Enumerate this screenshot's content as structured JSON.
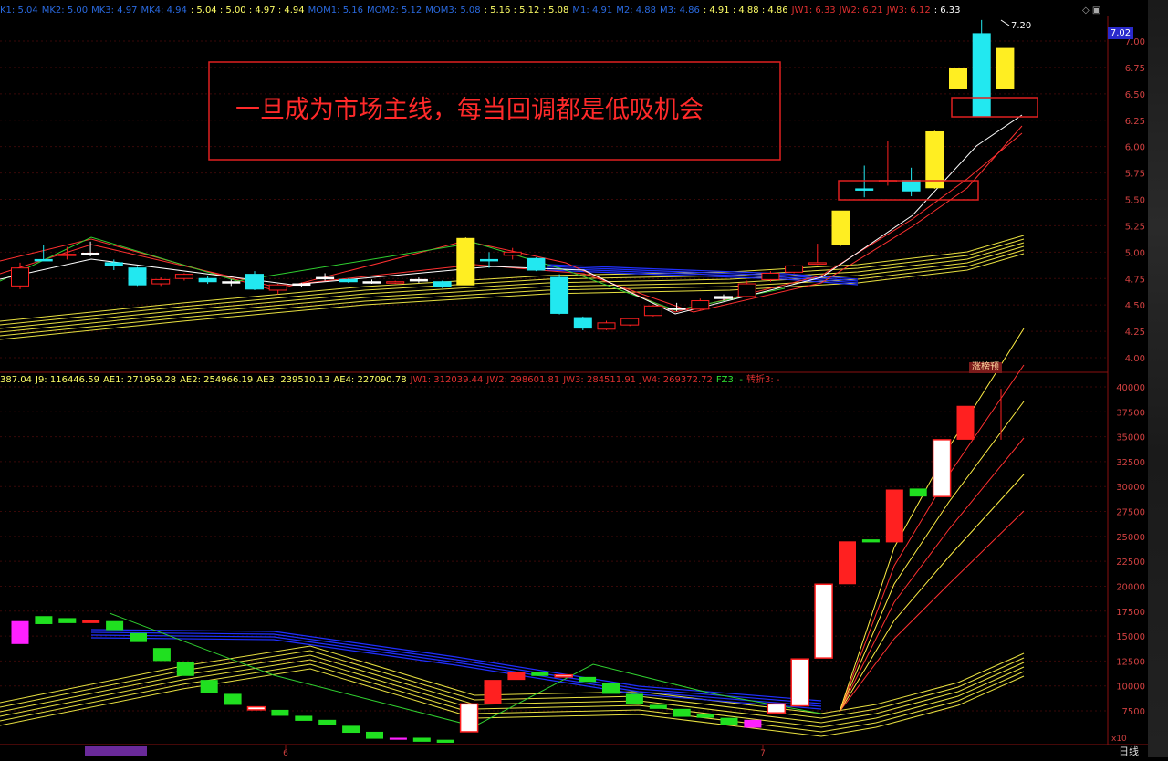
{
  "top_indicators": [
    {
      "text": "K1: 5.04",
      "color": "#2a6ae0"
    },
    {
      "text": "MK2: 5.00",
      "color": "#2a6ae0"
    },
    {
      "text": "MK3: 4.97",
      "color": "#2a6ae0"
    },
    {
      "text": "MK4: 4.94",
      "color": "#2a6ae0"
    },
    {
      "text": ": 5.04 : 5.00 : 4.97 : 4.94",
      "color": "#ffff66"
    },
    {
      "text": "MOM1: 5.16",
      "color": "#2a6ae0"
    },
    {
      "text": "MOM2: 5.12",
      "color": "#2a6ae0"
    },
    {
      "text": "MOM3: 5.08",
      "color": "#2a6ae0"
    },
    {
      "text": ": 5.16 : 5.12 : 5.08",
      "color": "#ffff66"
    },
    {
      "text": "M1: 4.91",
      "color": "#2a6ae0"
    },
    {
      "text": "M2: 4.88",
      "color": "#2a6ae0"
    },
    {
      "text": "M3: 4.86",
      "color": "#2a6ae0"
    },
    {
      "text": ": 4.91 : 4.88 : 4.86",
      "color": "#ffff66"
    },
    {
      "text": "JW1: 6.33",
      "color": "#e03030"
    },
    {
      "text": "JW2: 6.21",
      "color": "#e03030"
    },
    {
      "text": "JW3: 6.12",
      "color": "#e03030"
    },
    {
      "text": ": 6.33",
      "color": "#ffffff"
    }
  ],
  "bottom_indicators": [
    {
      "text": "387.04",
      "color": "#ffff66"
    },
    {
      "text": "J9: 116446.59",
      "color": "#ffff66"
    },
    {
      "text": "AE1: 271959.28",
      "color": "#ffff66"
    },
    {
      "text": "AE2: 254966.19",
      "color": "#ffff66"
    },
    {
      "text": "AE3: 239510.13",
      "color": "#ffff66"
    },
    {
      "text": "AE4: 227090.78",
      "color": "#ffff66"
    },
    {
      "text": "JW1: 312039.44",
      "color": "#e03030"
    },
    {
      "text": "JW2: 298601.81",
      "color": "#e03030"
    },
    {
      "text": "JW3: 284511.91",
      "color": "#e03030"
    },
    {
      "text": "JW4: 269372.72",
      "color": "#e03030"
    },
    {
      "text": "FZ3: -",
      "color": "#30e030"
    },
    {
      "text": "转折3: -",
      "color": "#e03030"
    }
  ],
  "annotation_text": "一旦成为市场主线，每当回调都是低吸机会",
  "price_badge": "7.02",
  "peak_label": "7.20",
  "zhangtingyu_label": "涨榜预",
  "period_label": "日线",
  "x_axis_labels": [
    "6",
    "7"
  ],
  "price_axis": {
    "ticks": [
      "7.00",
      "6.75",
      "6.50",
      "6.25",
      "6.00",
      "5.75",
      "5.50",
      "5.25",
      "5.00",
      "4.75",
      "4.50",
      "4.25",
      "4.00"
    ],
    "range": [
      3.9,
      7.3
    ]
  },
  "volume_axis": {
    "ticks": [
      "40000",
      "37500",
      "35000",
      "32500",
      "30000",
      "27500",
      "25000",
      "22500",
      "20000",
      "17500",
      "15000",
      "12500",
      "10000",
      "7500"
    ],
    "range": [
      5000,
      41000
    ]
  },
  "bottom_right_label": "x10",
  "chart_data": {
    "type": "candlestick",
    "price_candles": [
      [
        4.68,
        4.85,
        4.65,
        4.9,
        "red"
      ],
      [
        4.93,
        4.93,
        4.92,
        5.07,
        "cyan"
      ],
      [
        4.97,
        4.98,
        4.93,
        5.05,
        "red"
      ],
      [
        4.99,
        4.99,
        4.96,
        5.1,
        "white"
      ],
      [
        4.9,
        4.87,
        4.83,
        4.93,
        "cyan"
      ],
      [
        4.85,
        4.69,
        4.68,
        4.86,
        "cyan"
      ],
      [
        4.7,
        4.74,
        4.68,
        4.76,
        "red"
      ],
      [
        4.75,
        4.79,
        4.73,
        4.8,
        "red"
      ],
      [
        4.75,
        4.72,
        4.7,
        4.77,
        "cyan"
      ],
      [
        4.72,
        4.71,
        4.68,
        4.74,
        "white"
      ],
      [
        4.79,
        4.65,
        4.64,
        4.82,
        "cyan"
      ],
      [
        4.64,
        4.69,
        4.6,
        4.7,
        "red"
      ],
      [
        4.69,
        4.7,
        4.67,
        4.71,
        "white"
      ],
      [
        4.76,
        4.76,
        4.73,
        4.8,
        "white"
      ],
      [
        4.74,
        4.72,
        4.71,
        4.75,
        "cyan"
      ],
      [
        4.72,
        4.72,
        4.7,
        4.74,
        "white"
      ],
      [
        4.71,
        4.72,
        4.7,
        4.73,
        "red"
      ],
      [
        4.73,
        4.74,
        4.71,
        4.76,
        "white"
      ],
      [
        4.72,
        4.67,
        4.66,
        4.73,
        "cyan"
      ],
      [
        4.69,
        5.13,
        4.69,
        5.14,
        "yellow"
      ],
      [
        4.93,
        4.93,
        4.85,
        5.0,
        "cyan"
      ],
      [
        4.97,
        5.0,
        4.93,
        5.04,
        "red"
      ],
      [
        4.94,
        4.83,
        4.82,
        4.95,
        "cyan"
      ],
      [
        4.76,
        4.42,
        4.41,
        4.79,
        "cyan"
      ],
      [
        4.38,
        4.28,
        4.26,
        4.39,
        "cyan"
      ],
      [
        4.27,
        4.33,
        4.26,
        4.35,
        "red"
      ],
      [
        4.31,
        4.37,
        4.3,
        4.38,
        "red"
      ],
      [
        4.4,
        4.49,
        4.39,
        4.5,
        "red"
      ],
      [
        4.47,
        4.47,
        4.44,
        4.52,
        "white"
      ],
      [
        4.46,
        4.54,
        4.45,
        4.56,
        "red"
      ],
      [
        4.56,
        4.58,
        4.54,
        4.6,
        "white"
      ],
      [
        4.58,
        4.7,
        4.57,
        4.73,
        "red"
      ],
      [
        4.74,
        4.8,
        4.72,
        4.82,
        "red"
      ],
      [
        4.81,
        4.87,
        4.8,
        4.88,
        "red"
      ],
      [
        4.9,
        4.9,
        4.88,
        5.08,
        "red"
      ],
      [
        5.07,
        5.39,
        5.06,
        5.39,
        "yellow"
      ],
      [
        5.6,
        5.6,
        5.52,
        5.82,
        "cyan"
      ],
      [
        5.67,
        5.68,
        5.63,
        6.05,
        "red"
      ],
      [
        5.68,
        5.58,
        5.53,
        5.8,
        "cyan"
      ],
      [
        5.61,
        6.14,
        5.6,
        6.15,
        "yellow"
      ],
      [
        6.55,
        6.74,
        6.55,
        6.74,
        "yellow"
      ],
      [
        6.29,
        7.07,
        6.29,
        7.2,
        "cyan"
      ],
      [
        6.55,
        6.93,
        6.55,
        6.93,
        "yellow"
      ]
    ],
    "volume_bars": [
      [
        16500,
        14200,
        "magenta"
      ],
      [
        17000,
        16200,
        "green"
      ],
      [
        16800,
        16300,
        "green"
      ],
      [
        16600,
        16300,
        "red"
      ],
      [
        16500,
        15600,
        "green"
      ],
      [
        15300,
        14400,
        "green"
      ],
      [
        13800,
        12500,
        "green"
      ],
      [
        12400,
        11000,
        "green"
      ],
      [
        10600,
        9300,
        "green"
      ],
      [
        9200,
        8100,
        "green"
      ],
      [
        7900,
        7600,
        "white"
      ],
      [
        7600,
        7000,
        "green"
      ],
      [
        7000,
        6500,
        "green"
      ],
      [
        6600,
        6100,
        "green"
      ],
      [
        6000,
        5300,
        "green"
      ],
      [
        5400,
        4700,
        "green"
      ],
      [
        4800,
        4600,
        "magenta"
      ],
      [
        4800,
        4400,
        "green"
      ],
      [
        4600,
        4300,
        "green"
      ],
      [
        8200,
        5400,
        "white"
      ],
      [
        10600,
        8200,
        "red"
      ],
      [
        11400,
        10600,
        "red"
      ],
      [
        11400,
        11000,
        "green"
      ],
      [
        11100,
        10900,
        "white"
      ],
      [
        10900,
        10400,
        "green"
      ],
      [
        10300,
        9200,
        "green"
      ],
      [
        9200,
        8200,
        "green"
      ],
      [
        8100,
        7700,
        "green"
      ],
      [
        7700,
        6900,
        "green"
      ],
      [
        7200,
        6800,
        "green"
      ],
      [
        6800,
        6100,
        "green"
      ],
      [
        6600,
        5800,
        "magenta"
      ],
      [
        8200,
        7300,
        "white"
      ],
      [
        12700,
        8000,
        "white"
      ],
      [
        20200,
        12800,
        "white"
      ],
      [
        24500,
        20200,
        "red"
      ],
      [
        24700,
        24400,
        "green"
      ],
      [
        29700,
        24400,
        "red"
      ],
      [
        29800,
        29000,
        "green"
      ],
      [
        34700,
        29000,
        "white"
      ],
      [
        38100,
        34700,
        "red"
      ]
    ]
  }
}
